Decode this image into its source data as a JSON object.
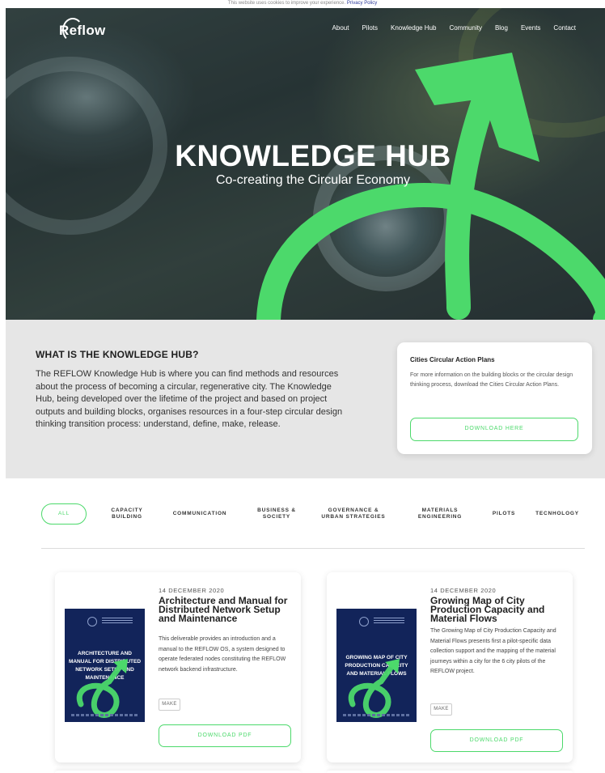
{
  "cookie": {
    "text": "This website uses cookies to improve your experience.",
    "link": "Privacy Policy"
  },
  "brand": {
    "logo": "Reflow",
    "accent_color": "#4cd96b"
  },
  "nav": {
    "items": [
      "About",
      "Pilots",
      "Knowledge Hub",
      "Community",
      "Blog",
      "Events",
      "Contact"
    ]
  },
  "hero": {
    "title": "KNOWLEDGE HUB",
    "subtitle": "Co-creating the Circular Economy"
  },
  "intro": {
    "title": "WHAT IS THE KNOWLEDGE HUB?",
    "text": "The REFLOW Knowledge Hub is where you can find methods and resources about the process of becoming a circular, regenerative city. The Knowledge Hub, being developed over the lifetime of the project and based on project outputs and building blocks, organises resources in a four-step circular design thinking transition process: understand, define, make, release.",
    "card": {
      "title": "Cities Circular Action Plans",
      "text": "For more information on the building blocks or the circular design thinking process, download the Cities Circular Action Plans.",
      "button": "DOWNLOAD HERE"
    }
  },
  "filters": {
    "active": "ALL",
    "items": [
      [
        "ALL"
      ],
      [
        "CAPACITY",
        "BUILDING"
      ],
      [
        "COMMUNICATION"
      ],
      [
        "BUSINESS &",
        "SOCIETY"
      ],
      [
        "GOVERNANCE &",
        "URBAN STRATEGIES"
      ],
      [
        "MATERIALS",
        "ENGINEERING"
      ],
      [
        "PILOTS"
      ],
      [
        "TECNHOLOGY"
      ]
    ]
  },
  "cards": [
    {
      "date": "14 DECEMBER 2020",
      "title": "Architecture and Manual for Distributed Network Setup and Maintenance",
      "description": "This deliverable provides an introduction and a manual to the REFLOW OS, a system designed to operate federated nodes constituting the REFLOW network backend infrastructure.",
      "cover_title": "ARCHITECTURE AND MANUAL FOR DISTRIBUTED NETWORK SETUP AND MAINTENANCE",
      "tag": "MAKE",
      "button": "DOWNLOAD PDF"
    },
    {
      "date": "14 DECEMBER 2020",
      "title": "Growing Map of City Production Capacity and Material Flows",
      "description": "The Growing Map of City Production Capacity and Material Flows presents first a pilot-specific data collection support and the mapping of the material journeys within a city for the 6 city pilots of the REFLOW project.",
      "cover_title": "GROWING MAP OF CITY PRODUCTION CAPACITY AND MATERIAL FLOWS",
      "tag": "MAKE",
      "button": "DOWNLOAD PDF"
    }
  ]
}
